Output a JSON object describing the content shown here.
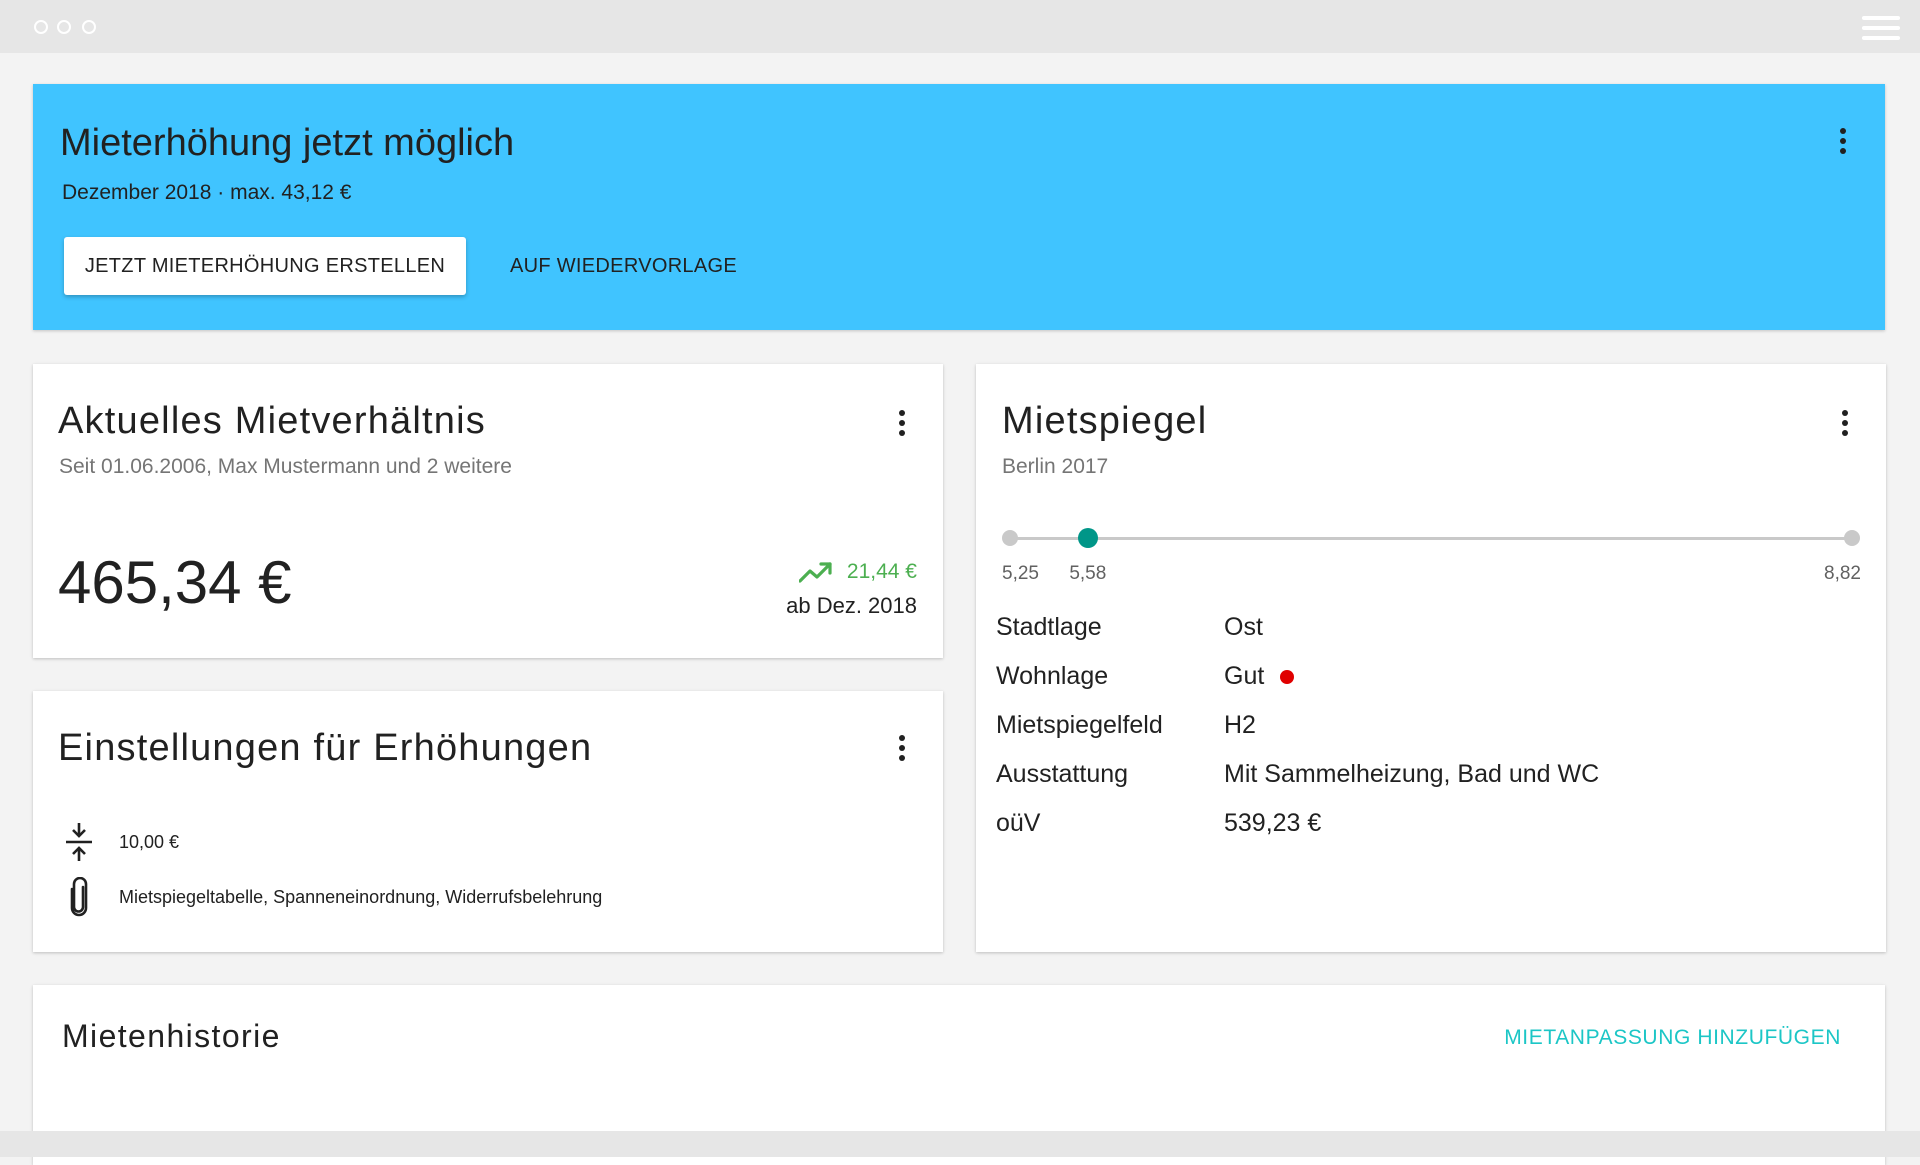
{
  "banner": {
    "title": "Mieterhöhung jetzt möglich",
    "subtitle": "Dezember 2018 · max. 43,12 €",
    "primary_button": "JETZT MIETERHÖHUNG ERSTELLEN",
    "secondary_button": "AUF WIEDERVORLAGE",
    "background_color": "#40c4ff"
  },
  "rent_card": {
    "title": "Aktuelles Mietverhältnis",
    "subtitle": "Seit 01.06.2006, Max Mustermann und 2 weitere",
    "amount": "465,34 €",
    "trend_value": "21,44 €",
    "trend_date": "ab Dez. 2018",
    "trend_icon": "trending-up-icon",
    "trend_color": "#4caf50"
  },
  "settings_card": {
    "title": "Einstellungen für Erhöhungen",
    "rows": [
      {
        "icon": "compress-vertical-icon",
        "text": "10,00 €"
      },
      {
        "icon": "paperclip-icon",
        "text": "Mietspiegeltabelle, Spanneneinordnung, Widerrufsbelehrung"
      }
    ]
  },
  "mietspiegel_card": {
    "title": "Mietspiegel",
    "subtitle": "Berlin 2017",
    "slider": {
      "min_label": "5,25",
      "value_label": "5,58",
      "max_label": "8,82",
      "min": 5.25,
      "max": 8.82,
      "value": 5.58,
      "accent_color": "#009688"
    },
    "attributes": [
      {
        "label": "Stadtlage",
        "value": "Ost"
      },
      {
        "label": "Wohnlage",
        "value": "Gut",
        "status_color": "#e00000"
      },
      {
        "label": "Mietspiegelfeld",
        "value": "H2"
      },
      {
        "label": "Ausstattung",
        "value": "Mit Sammelheizung, Bad und WC"
      },
      {
        "label": "oüV",
        "value": "539,23 €"
      }
    ]
  },
  "history_card": {
    "title": "Mietenhistorie",
    "action": "MIETANPASSUNG HINZUFÜGEN",
    "action_color": "#1cc6c6"
  }
}
